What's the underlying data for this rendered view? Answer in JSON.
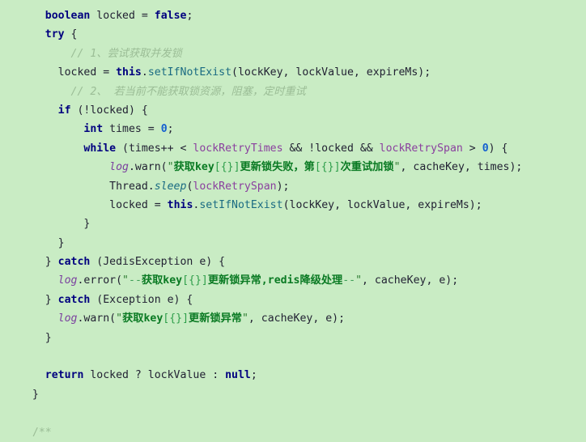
{
  "editor": {
    "language": "Java",
    "background_color": "#c9ecc4",
    "font_family_kind": "monospace",
    "colors": {
      "keyword": "#00007f",
      "plain": "#222233",
      "number": "#1560d0",
      "method": "#1a6b82",
      "field": "#8a3f9e",
      "logger_variable": "#7a3f9e",
      "comment": "#9bbd96",
      "string": "#2e7d32",
      "string_cjk": "#0a7a23",
      "string_placeholder": "#2e9e4a"
    }
  },
  "code": {
    "lines": [
      {
        "id": 1,
        "text": "    boolean locked = false;",
        "tokens": [
          {
            "t": "    ",
            "c": "plain"
          },
          {
            "t": "boolean",
            "c": "kw"
          },
          {
            "t": " locked ",
            "c": "plain"
          },
          {
            "t": "=",
            "c": "plain"
          },
          {
            "t": " ",
            "c": "plain"
          },
          {
            "t": "false",
            "c": "kw"
          },
          {
            "t": ";",
            "c": "plain"
          }
        ]
      },
      {
        "id": 2,
        "text": "    try {",
        "tokens": [
          {
            "t": "    ",
            "c": "plain"
          },
          {
            "t": "try",
            "c": "kw"
          },
          {
            "t": " {",
            "c": "plain"
          }
        ]
      },
      {
        "id": 3,
        "text": "        // 1、尝试获取并发锁",
        "tokens": [
          {
            "t": "        ",
            "c": "plain"
          },
          {
            "t": "// 1、尝试获取并发锁",
            "c": "comment"
          }
        ]
      },
      {
        "id": 4,
        "text": "      locked = this.setIfNotExist(lockKey, lockValue, expireMs);",
        "tokens": [
          {
            "t": "      locked = ",
            "c": "plain"
          },
          {
            "t": "this",
            "c": "kw"
          },
          {
            "t": ".",
            "c": "plain"
          },
          {
            "t": "setIfNotExist",
            "c": "method"
          },
          {
            "t": "(lockKey, lockValue, expireMs);",
            "c": "plain"
          }
        ]
      },
      {
        "id": 5,
        "text": "        // 2、 若当前不能获取锁资源，阻塞，定时重试",
        "tokens": [
          {
            "t": "        ",
            "c": "plain"
          },
          {
            "t": "// 2、 若当前不能获取锁资源，阻塞，定时重试",
            "c": "comment"
          }
        ]
      },
      {
        "id": 6,
        "text": "      if (!locked) {",
        "tokens": [
          {
            "t": "      ",
            "c": "plain"
          },
          {
            "t": "if",
            "c": "kw"
          },
          {
            "t": " (!locked) {",
            "c": "plain"
          }
        ]
      },
      {
        "id": 7,
        "text": "          int times = 0;",
        "tokens": [
          {
            "t": "          ",
            "c": "plain"
          },
          {
            "t": "int",
            "c": "kw"
          },
          {
            "t": " times = ",
            "c": "plain"
          },
          {
            "t": "0",
            "c": "num"
          },
          {
            "t": ";",
            "c": "plain"
          }
        ]
      },
      {
        "id": 8,
        "text": "          while (times++ < lockRetryTimes && !locked && lockRetrySpan > 0) {",
        "tokens": [
          {
            "t": "          ",
            "c": "plain"
          },
          {
            "t": "while",
            "c": "kw"
          },
          {
            "t": " (times++ < ",
            "c": "plain"
          },
          {
            "t": "lockRetryTimes",
            "c": "field"
          },
          {
            "t": " && !locked && ",
            "c": "plain"
          },
          {
            "t": "lockRetrySpan",
            "c": "field"
          },
          {
            "t": " > ",
            "c": "plain"
          },
          {
            "t": "0",
            "c": "num"
          },
          {
            "t": ") {",
            "c": "plain"
          }
        ]
      },
      {
        "id": 9,
        "text": "              log.warn(\"获取key[{}]更新锁失败，第[{}]次重试加锁\", cacheKey, times);",
        "tokens": [
          {
            "t": "              ",
            "c": "plain"
          },
          {
            "t": "log",
            "c": "logvar"
          },
          {
            "t": ".warn(",
            "c": "plain"
          },
          {
            "t": "\"",
            "c": "str"
          },
          {
            "t": "获取",
            "c": "strcjk"
          },
          {
            "t": "key",
            "c": "strcjk"
          },
          {
            "t": "[{}]",
            "c": "strph"
          },
          {
            "t": "更新锁失败，第",
            "c": "strcjk"
          },
          {
            "t": "[{}]",
            "c": "strph"
          },
          {
            "t": "次重试加锁",
            "c": "strcjk"
          },
          {
            "t": "\"",
            "c": "str"
          },
          {
            "t": ", cacheKey, times);",
            "c": "plain"
          }
        ]
      },
      {
        "id": 10,
        "text": "              Thread.sleep(lockRetrySpan);",
        "tokens": [
          {
            "t": "              Thread.",
            "c": "plain"
          },
          {
            "t": "sleep",
            "c": "smethod"
          },
          {
            "t": "(",
            "c": "plain"
          },
          {
            "t": "lockRetrySpan",
            "c": "field"
          },
          {
            "t": ");",
            "c": "plain"
          }
        ]
      },
      {
        "id": 11,
        "text": "              locked = this.setIfNotExist(lockKey, lockValue, expireMs);",
        "tokens": [
          {
            "t": "              locked = ",
            "c": "plain"
          },
          {
            "t": "this",
            "c": "kw"
          },
          {
            "t": ".",
            "c": "plain"
          },
          {
            "t": "setIfNotExist",
            "c": "method"
          },
          {
            "t": "(lockKey, lockValue, expireMs);",
            "c": "plain"
          }
        ]
      },
      {
        "id": 12,
        "text": "          }",
        "tokens": [
          {
            "t": "          }",
            "c": "plain"
          }
        ]
      },
      {
        "id": 13,
        "text": "      }",
        "tokens": [
          {
            "t": "      }",
            "c": "plain"
          }
        ]
      },
      {
        "id": 14,
        "text": "    } catch (JedisException e) {",
        "tokens": [
          {
            "t": "    } ",
            "c": "plain"
          },
          {
            "t": "catch",
            "c": "kw"
          },
          {
            "t": " (JedisException e) {",
            "c": "plain"
          }
        ]
      },
      {
        "id": 15,
        "text": "      log.error(\"--获取key[{}]更新锁异常,redis降级处理--\", cacheKey, e);",
        "tokens": [
          {
            "t": "      ",
            "c": "plain"
          },
          {
            "t": "log",
            "c": "logvar"
          },
          {
            "t": ".error(",
            "c": "plain"
          },
          {
            "t": "\"",
            "c": "str"
          },
          {
            "t": "--",
            "c": "strdash"
          },
          {
            "t": "获取",
            "c": "strcjk"
          },
          {
            "t": "key",
            "c": "strcjk"
          },
          {
            "t": "[{}]",
            "c": "strph"
          },
          {
            "t": "更新锁异常",
            "c": "strcjk"
          },
          {
            "t": ",",
            "c": "strcjk"
          },
          {
            "t": "redis",
            "c": "strcjk"
          },
          {
            "t": "降级处理",
            "c": "strcjk"
          },
          {
            "t": "--",
            "c": "strdash"
          },
          {
            "t": "\"",
            "c": "str"
          },
          {
            "t": ", cacheKey, e);",
            "c": "plain"
          }
        ]
      },
      {
        "id": 16,
        "text": "    } catch (Exception e) {",
        "tokens": [
          {
            "t": "    } ",
            "c": "plain"
          },
          {
            "t": "catch",
            "c": "kw"
          },
          {
            "t": " (Exception e) {",
            "c": "plain"
          }
        ]
      },
      {
        "id": 17,
        "text": "      log.warn(\"获取key[{}]更新锁异常\", cacheKey, e);",
        "tokens": [
          {
            "t": "      ",
            "c": "plain"
          },
          {
            "t": "log",
            "c": "logvar"
          },
          {
            "t": ".warn(",
            "c": "plain"
          },
          {
            "t": "\"",
            "c": "str"
          },
          {
            "t": "获取",
            "c": "strcjk"
          },
          {
            "t": "key",
            "c": "strcjk"
          },
          {
            "t": "[{}]",
            "c": "strph"
          },
          {
            "t": "更新锁异常",
            "c": "strcjk"
          },
          {
            "t": "\"",
            "c": "str"
          },
          {
            "t": ", cacheKey, e);",
            "c": "plain"
          }
        ]
      },
      {
        "id": 18,
        "text": "    }",
        "tokens": [
          {
            "t": "    }",
            "c": "plain"
          }
        ]
      },
      {
        "id": 19,
        "text": "",
        "tokens": []
      },
      {
        "id": 20,
        "text": "    return locked ? lockValue : null;",
        "tokens": [
          {
            "t": "    ",
            "c": "plain"
          },
          {
            "t": "return",
            "c": "kw"
          },
          {
            "t": " locked ? lockValue : ",
            "c": "plain"
          },
          {
            "t": "null",
            "c": "kw"
          },
          {
            "t": ";",
            "c": "plain"
          }
        ]
      },
      {
        "id": 21,
        "text": "  }",
        "tokens": [
          {
            "t": "  }",
            "c": "plain"
          }
        ]
      },
      {
        "id": 22,
        "text": "",
        "tokens": []
      },
      {
        "id": 23,
        "text": "  /**",
        "tokens": [
          {
            "t": "  ",
            "c": "plain"
          },
          {
            "t": "/**",
            "c": "docstart"
          }
        ]
      }
    ]
  }
}
